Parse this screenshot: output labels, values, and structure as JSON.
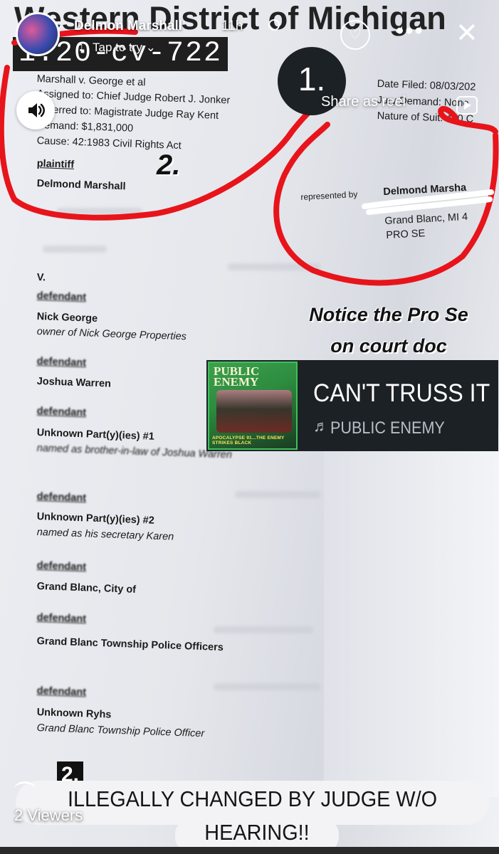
{
  "story": {
    "user_name": "Delmon Marshall",
    "time_ago": "11h",
    "tap_to_try": "Tap to try",
    "share_as_reel": "Share as reel",
    "viewers": "2 Viewers"
  },
  "document": {
    "court_title": "Western District of Michigan",
    "case_number": "1:20-cv-722",
    "case_name": "Marshall v. George et al",
    "assigned": "Assigned to: Chief Judge Robert J. Jonker",
    "referred": "Referred to: Magistrate Judge Ray Kent",
    "demand": "Demand: $1,831,000",
    "cause": "Cause: 42:1983 Civil Rights Act",
    "date_filed": "Date Filed: 08/03/202",
    "jury_demand": "Jury Demand: None",
    "nature_of_suit": "Nature of Suit: 440 C",
    "plaintiff_label": "plaintiff",
    "plaintiff_name": "Delmond Marshall",
    "represented_by": "represented by",
    "rep_name": "Delmond Marsha",
    "rep_city": "Grand Blanc, MI 4",
    "rep_status": "PRO SE",
    "versus": "V.",
    "defendants": [
      {
        "label": "defendant",
        "name": "Nick George",
        "desc": "owner of Nick George Properties"
      },
      {
        "label": "defendant",
        "name": "Joshua Warren",
        "desc": ""
      },
      {
        "label": "defendant",
        "name": "Unknown Part(y)(ies) #1",
        "desc": "named as brother-in-law of Joshua Warren"
      },
      {
        "label": "defendant",
        "name": "Unknown Part(y)(ies) #2",
        "desc": "named as his secretary Karen"
      },
      {
        "label": "defendant",
        "name": "Grand Blanc, City of",
        "desc": ""
      },
      {
        "label": "defendant",
        "name": "Grand Blanc Township Police Officers",
        "desc": ""
      },
      {
        "label": "defendant",
        "name": "Unknown Ryhs",
        "desc": "Grand Blanc Township Police Officer"
      }
    ]
  },
  "annotations": {
    "marker_1": "1.",
    "marker_2_top": "2.",
    "notice_line1": "Notice the Pro Se",
    "notice_line2": "on court doc",
    "marker_2_bottom": "2.",
    "caption_line1": "ILLEGALLY CHANGED BY JUDGE W/O",
    "caption_line2": "HEARING!!"
  },
  "music": {
    "song": "CAN'T TRUSS IT",
    "artist": "PUBLIC ENEMY",
    "album_title": "PUBLIC ENEMY",
    "album_subtitle": "APOCALYPSE 91...THE ENEMY STRIKES BLACK",
    "note_icon": "music-note-icon"
  },
  "colors": {
    "marker_red": "#e8141b",
    "card_bg": "#1c2126",
    "album_green": "#3ec15a"
  }
}
